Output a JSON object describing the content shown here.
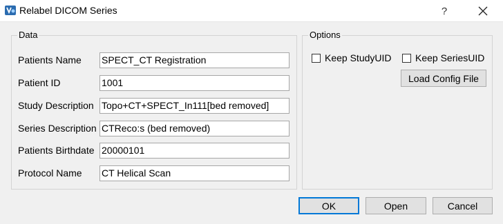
{
  "window": {
    "title": "Relabel DICOM Series",
    "help_symbol": "?"
  },
  "data_group": {
    "title": "Data",
    "fields": [
      {
        "label": "Patients Name",
        "value": "SPECT_CT Registration"
      },
      {
        "label": "Patient ID",
        "value": "1001"
      },
      {
        "label": "Study Description",
        "value": "Topo+CT+SPECT_In111[bed removed]"
      },
      {
        "label": "Series Description",
        "value": "CTReco:s (bed removed)"
      },
      {
        "label": "Patients Birthdate",
        "value": "20000101"
      },
      {
        "label": "Protocol Name",
        "value": "CT Helical Scan"
      }
    ]
  },
  "options_group": {
    "title": "Options",
    "keep_study_uid": {
      "label": "Keep StudyUID",
      "checked": false
    },
    "keep_series_uid": {
      "label": "Keep SeriesUID",
      "checked": false
    },
    "load_config_label": "Load Config File"
  },
  "buttons": {
    "ok": "OK",
    "open": "Open",
    "cancel": "Cancel"
  },
  "colors": {
    "accent": "#0078d7",
    "app_icon": "#2b6cb0"
  }
}
